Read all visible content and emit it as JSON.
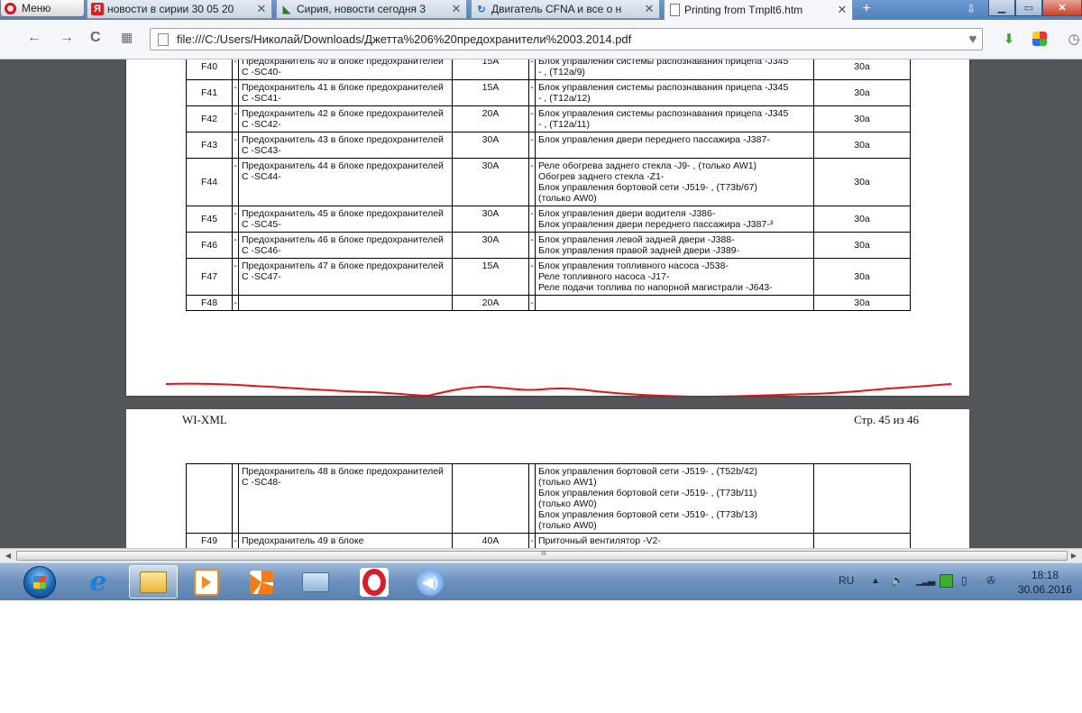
{
  "browser": {
    "menu_label": "Меню",
    "tabs": [
      {
        "title": "новости в сирии 30 05 20",
        "favicon": "yandex-icon",
        "active": false
      },
      {
        "title": "Сирия, новости сегодня 3",
        "favicon": "rss-icon",
        "active": false
      },
      {
        "title": "Двигатель CFNA и все о н",
        "favicon": "reload-icon",
        "active": false
      },
      {
        "title": "Printing from Tmplt6.htm",
        "favicon": "page-icon",
        "active": true
      }
    ],
    "tab_close_glyph": "✕",
    "new_tab_glyph": "+",
    "url": "file:///C:/Users/Николай/Downloads/Джетта%206%20предохранители%2003.2014.pdf"
  },
  "pdf": {
    "page1": {
      "rows": [
        {
          "id": "F40",
          "dash": "-",
          "name": "Предохранитель 40 в блоке предохранителей С -SC40-",
          "amp": "15A",
          "dash2": "-",
          "desc": [
            "Блок управления системы распознавания прицепа -J345",
            "- , (T12a/9)"
          ],
          "rating": "30a"
        },
        {
          "id": "F41",
          "dash": "-",
          "name": "Предохранитель 41 в блоке предохранителей С -SC41-",
          "amp": "15A",
          "dash2": "-",
          "desc": [
            "Блок управления системы распознавания прицепа -J345",
            "- , (T12a/12)"
          ],
          "rating": "30a"
        },
        {
          "id": "F42",
          "dash": "-",
          "name": "Предохранитель 42 в блоке предохранителей С -SC42-",
          "amp": "20A",
          "dash2": "-",
          "desc": [
            "Блок управления системы распознавания прицепа -J345",
            "- , (T12a/11)"
          ],
          "rating": "30a"
        },
        {
          "id": "F43",
          "dash": "-",
          "name": "Предохранитель 43 в блоке предохранителей С -SC43-",
          "amp": "30A",
          "dash2": "-",
          "desc": [
            "Блок управления двери переднего пассажира -J387-"
          ],
          "rating": "30a"
        },
        {
          "id": "F44",
          "dash": "-",
          "name": "Предохранитель 44 в блоке предохранителей С -SC44-",
          "amp": "30A",
          "dash2": "-",
          "desc": [
            "Реле обогрева заднего стекла -J9- , (только AW1)",
            "Обогрев заднего стекла -Z1-",
            "Блок управления бортовой сети -J519- , (T73b/67)",
            "(только AW0)"
          ],
          "rating": "30a"
        },
        {
          "id": "F45",
          "dash": "-",
          "name": "Предохранитель 45 в блоке предохранителей С -SC45-",
          "amp": "30A",
          "dash2": "-",
          "desc": [
            "Блок управления двери водителя -J386-",
            "Блок управления двери переднего пассажира -J387-³"
          ],
          "rating": "30a"
        },
        {
          "id": "F46",
          "dash": "-",
          "name": "Предохранитель 46 в блоке предохранителей С -SC46-",
          "amp": "30A",
          "dash2": "-",
          "desc": [
            "Блок управления левой задней двери -J388-",
            "Блок управления правой задней двери -J389-"
          ],
          "rating": "30a"
        },
        {
          "id": "F47",
          "dash": "-",
          "name": "Предохранитель 47 в блоке предохранителей С -SC47-",
          "amp": "15A",
          "dash2": "-",
          "desc": [
            "Блок управления топливного насоса -J538-",
            "Реле топливного насоса -J17-",
            "Реле подачи топлива по напорной магистрали -J643-"
          ],
          "rating": "30a"
        },
        {
          "id": "F48",
          "dash": "-",
          "name": "",
          "amp": "20A",
          "dash2": "-",
          "desc": [
            ""
          ],
          "rating": "30a"
        }
      ]
    },
    "page2": {
      "header_left": "WI-XML",
      "header_right": "Стр. 45 из 46",
      "rows": [
        {
          "id": "",
          "dash": "",
          "name": "Предохранитель 48 в блоке предохранителей С -SC48-",
          "amp": "",
          "dash2": "",
          "desc": [
            "Блок управления бортовой сети -J519- , (T52b/42)",
            "(только AW1)",
            "Блок управления бортовой сети -J519- , (T73b/11)",
            "(только AW0)",
            "Блок управления бортовой сети -J519- , (T73b/13)",
            "(только AW0)"
          ],
          "rating": ""
        },
        {
          "id": "F49",
          "dash": "-",
          "name": "Предохранитель 49 в блоке",
          "amp": "40A",
          "dash2": "-",
          "desc": [
            "Приточный вентилятор -V2-"
          ],
          "rating": ""
        }
      ]
    },
    "annotation_color": "#e0161b"
  },
  "scrollbar": {
    "grip": "III"
  },
  "taskbar": {
    "apps": [
      {
        "name": "ie-icon"
      },
      {
        "name": "explorer-icon",
        "active": true
      },
      {
        "name": "media-player-icon"
      },
      {
        "name": "office-icon"
      },
      {
        "name": "network-icon"
      },
      {
        "name": "opera-icon"
      },
      {
        "name": "speaker-app-icon"
      }
    ],
    "language": "RU",
    "time": "18:18",
    "date": "30.06.2016"
  }
}
